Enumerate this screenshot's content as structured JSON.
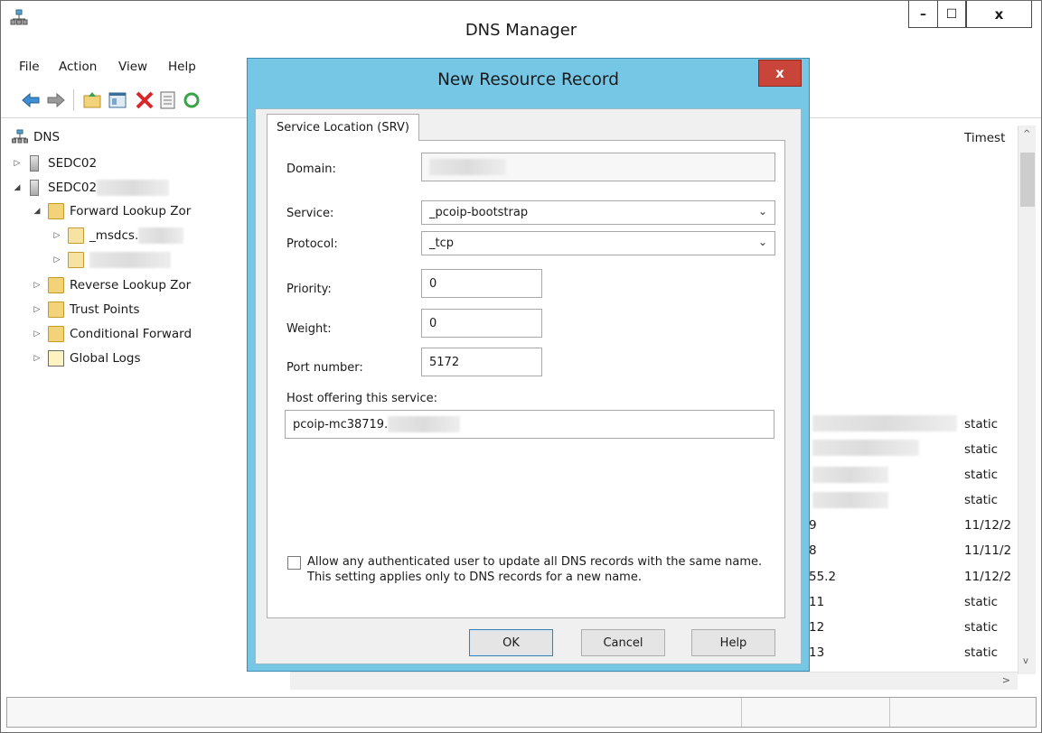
{
  "main_window": {
    "title": "DNS Manager",
    "buttons": {
      "minimize": "–",
      "maximize": "☐",
      "close": "x"
    }
  },
  "menu": [
    "File",
    "Action",
    "View",
    "Help"
  ],
  "toolbar": [
    "back-arrow-icon",
    "forward-arrow-icon",
    "up-folder-icon",
    "show-hide-console-tree-icon",
    "delete-icon",
    "properties-icon",
    "refresh-icon"
  ],
  "tree": {
    "root": "DNS",
    "items": [
      {
        "label": "SEDC02",
        "level": 1,
        "expanded": false,
        "blurred_suffix": false
      },
      {
        "label": "SEDC02",
        "level": 1,
        "expanded": true,
        "blurred_suffix": true
      },
      {
        "label": "Forward Lookup Zor",
        "level": 2,
        "expanded": true
      },
      {
        "label": "_msdcs.",
        "level": 3,
        "expanded": false,
        "blurred_suffix": true
      },
      {
        "label": "",
        "level": 3,
        "expanded": false,
        "blurred_suffix": true
      },
      {
        "label": "Reverse Lookup Zor",
        "level": 2,
        "expanded": false
      },
      {
        "label": "Trust Points",
        "level": 2,
        "expanded": false
      },
      {
        "label": "Conditional Forward",
        "level": 2,
        "expanded": false
      },
      {
        "label": "Global Logs",
        "level": 1,
        "expanded": false
      }
    ]
  },
  "list": {
    "timestamp_header": "Timest",
    "rows": [
      {
        "data": "",
        "timestamp": "static"
      },
      {
        "data": "",
        "timestamp": "static"
      },
      {
        "data": "",
        "timestamp": "static"
      },
      {
        "data": "",
        "timestamp": "static"
      },
      {
        "data": "9",
        "timestamp": "11/12/2"
      },
      {
        "data": "8",
        "timestamp": "11/11/2"
      },
      {
        "data": "55.2",
        "timestamp": "11/12/2"
      },
      {
        "data": "11",
        "timestamp": "static"
      },
      {
        "data": "12",
        "timestamp": "static"
      },
      {
        "data": "13",
        "timestamp": "static"
      }
    ]
  },
  "dialog": {
    "title": "New Resource Record",
    "close": "x",
    "tab": "Service Location (SRV)",
    "domain": {
      "label": "Domain:",
      "value": ""
    },
    "service": {
      "label": "Service:",
      "value": "_pcoip-bootstrap"
    },
    "protocol": {
      "label": "Protocol:",
      "value": "_tcp"
    },
    "priority": {
      "label": "Priority:",
      "value": "0"
    },
    "weight": {
      "label": "Weight:",
      "value": "0"
    },
    "port": {
      "label": "Port number:",
      "value": "5172"
    },
    "host": {
      "label": "Host offering this service:",
      "value": "pcoip-mc38719."
    },
    "checkbox_label": "Allow any authenticated user to update all DNS records with the same name. This setting applies only to DNS records for a new name.",
    "checkbox_checked": false,
    "buttons": {
      "ok": "OK",
      "cancel": "Cancel",
      "help": "Help"
    }
  }
}
